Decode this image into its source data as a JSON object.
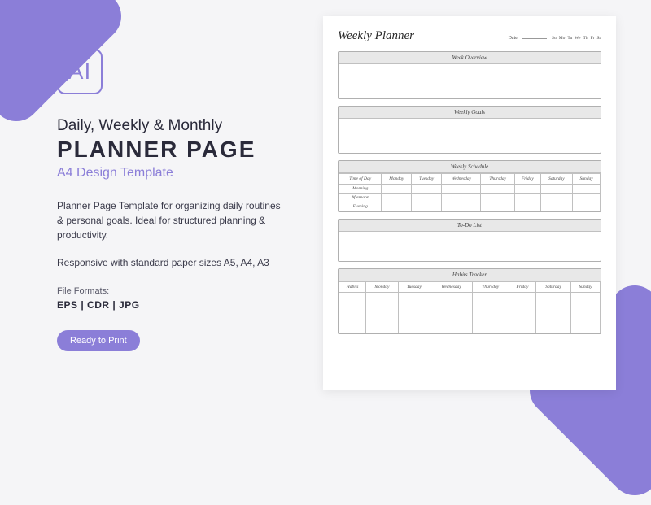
{
  "logo": {
    "text": "AI"
  },
  "heading": {
    "line1": "Daily, Weekly & Monthly",
    "line2": "PLANNER PAGE",
    "subtitle": "A4 Design Template"
  },
  "description": "Planner Page Template for organizing daily routines & personal goals. Ideal for structured planning & productivity.",
  "responsive": "Responsive with standard paper sizes A5, A4, A3",
  "formats": {
    "label": "File Formats:",
    "list": "EPS  |  CDR  |  JPG"
  },
  "badge": "Ready to Print",
  "planner": {
    "title": "Weekly Planner",
    "date_label": "Date",
    "days_short": [
      "Su",
      "Mo",
      "Tu",
      "We",
      "Th",
      "Fr",
      "Sa"
    ],
    "sections": {
      "overview": "Week Overview",
      "goals": "Weekly Goals",
      "schedule": "Weekly Schedule",
      "todo": "To-Do List",
      "habits": "Habits Tracker"
    },
    "schedule": {
      "time_col": "Time of Day",
      "days": [
        "Monday",
        "Tuesday",
        "Wednesday",
        "Thursday",
        "Friday",
        "Saturday",
        "Sunday"
      ],
      "rows": [
        "Morning",
        "Afternoon",
        "Evening"
      ]
    },
    "habits": {
      "habits_col": "Habits",
      "days": [
        "Monday",
        "Tuesday",
        "Wednesday",
        "Thursday",
        "Friday",
        "Saturday",
        "Sunday"
      ]
    }
  }
}
